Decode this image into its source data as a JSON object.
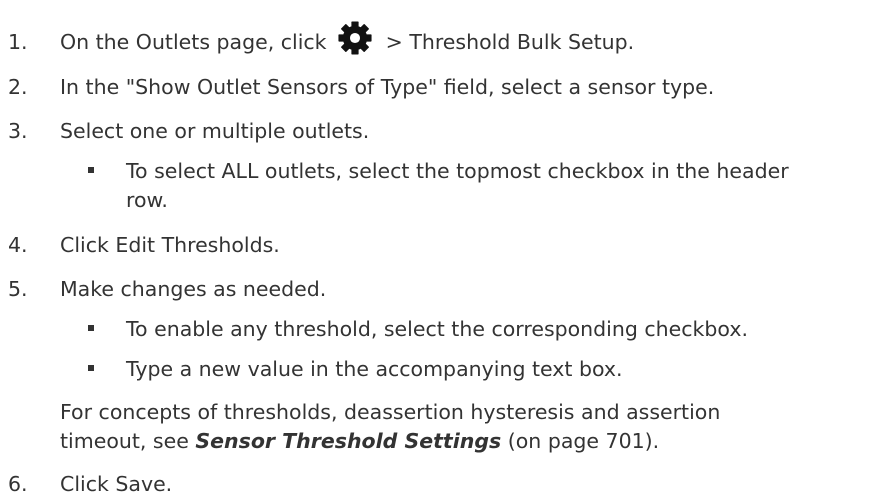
{
  "steps": [
    {
      "number": "1.",
      "before_icon": "On the Outlets page, click",
      "icon": "gear-icon",
      "after_icon": "> Threshold Bulk Setup."
    },
    {
      "number": "2.",
      "text": "In the \"Show Outlet Sensors of Type\" field, select a sensor type."
    },
    {
      "number": "3.",
      "text": "Select one or multiple outlets.",
      "bullets": [
        {
          "line1": "To select ALL outlets, select the topmost checkbox in the header",
          "line2": "row."
        }
      ]
    },
    {
      "number": "4.",
      "text": "Click Edit Thresholds."
    },
    {
      "number": "5.",
      "text": "Make changes as needed.",
      "bullets": [
        {
          "line1": "To enable any threshold, select the corresponding checkbox."
        },
        {
          "line1": "Type a new value in the accompanying text box."
        }
      ],
      "note": {
        "line1": "For concepts of thresholds, deassertion hysteresis and assertion",
        "line2_before": "timeout, see",
        "link": "Sensor Threshold Settings",
        "line2_after": "(on page 701)."
      }
    },
    {
      "number": "6.",
      "text": "Click Save."
    }
  ]
}
